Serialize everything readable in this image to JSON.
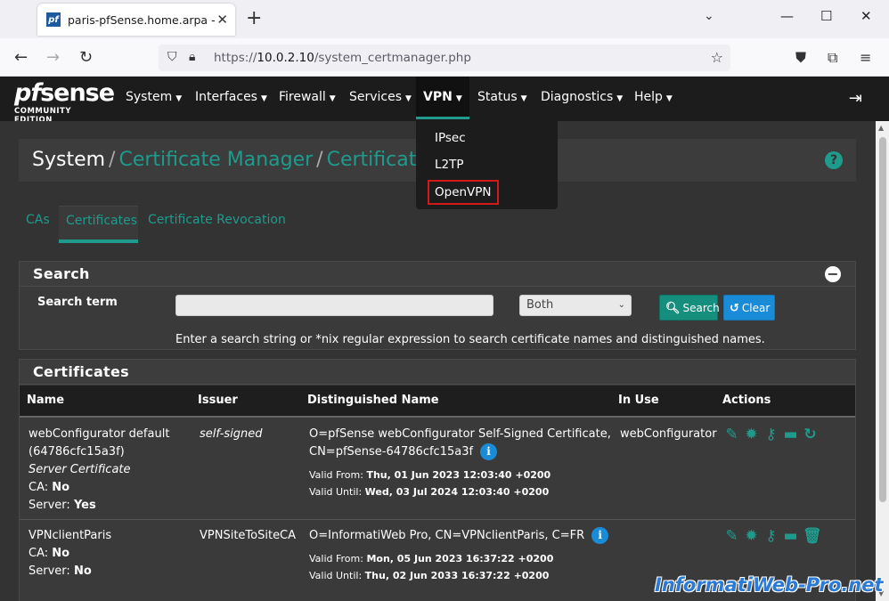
{
  "browser": {
    "tab_title": "paris-pfSense.home.arpa - System",
    "tab_favicon_text": "pf",
    "url_prefix": "https://",
    "url_host": "10.0.2.10",
    "url_path": "/system_certmanager.php"
  },
  "pfsense": {
    "logo_main_pf": "pf",
    "logo_main_sense": "sense",
    "logo_sub": "COMMUNITY EDITION",
    "menu": [
      {
        "label": "System"
      },
      {
        "label": "Interfaces"
      },
      {
        "label": "Firewall"
      },
      {
        "label": "Services"
      },
      {
        "label": "VPN"
      },
      {
        "label": "Status"
      },
      {
        "label": "Diagnostics"
      },
      {
        "label": "Help"
      }
    ],
    "vpn_dropdown": [
      "IPsec",
      "L2TP",
      "OpenVPN"
    ]
  },
  "breadcrumb": {
    "root": "System",
    "level1": "Certificate Manager",
    "level2": "Certificates",
    "sep": "/"
  },
  "tabs": [
    "CAs",
    "Certificates",
    "Certificate Revocation"
  ],
  "search": {
    "heading": "Search",
    "label": "Search term",
    "input_value": "",
    "select_value": "Both",
    "search_button": "Search",
    "clear_button": "Clear",
    "help_text": "Enter a search string or *nix regular expression to search certificate names and distinguished names."
  },
  "certificates": {
    "heading": "Certificates",
    "columns": [
      "Name",
      "Issuer",
      "Distinguished Name",
      "In Use",
      "Actions"
    ],
    "rows": [
      {
        "name": "webConfigurator default",
        "name_id": "(64786cfc15a3f)",
        "type": "Server Certificate",
        "ca_label": "CA:",
        "ca_value": "No",
        "server_label": "Server:",
        "server_value": "Yes",
        "issuer": "self-signed",
        "dn_line1": "O=pfSense webConfigurator Self-Signed Certificate,",
        "dn_line2": "CN=pfSense-64786cfc15a3f",
        "valid_from_label": "Valid From:",
        "valid_from": "Thu, 01 Jun 2023 12:03:40 +0200",
        "valid_until_label": "Valid Until:",
        "valid_until": "Wed, 03 Jul 2024 12:03:40 +0200",
        "in_use": "webConfigurator"
      },
      {
        "name": "VPNclientParis",
        "ca_label": "CA:",
        "ca_value": "No",
        "server_label": "Server:",
        "server_value": "No",
        "issuer": "VPNSiteToSiteCA",
        "dn_line1": "O=InformatiWeb Pro, CN=VPNclientParis, C=FR",
        "valid_from_label": "Valid From:",
        "valid_from": "Mon, 05 Jun 2023 16:37:22 +0200",
        "valid_until_label": "Valid Until:",
        "valid_until": "Thu, 02 Jun 2033 16:37:22 +0200",
        "in_use": ""
      }
    ]
  },
  "watermark": "InformatiWeb-Pro.net",
  "colors": {
    "accent": "#1e9b8c",
    "header_bg": "#1c1c1c",
    "content_bg": "#333333",
    "info_blue": "#1a8bd6",
    "highlight_red": "#d4191b"
  }
}
